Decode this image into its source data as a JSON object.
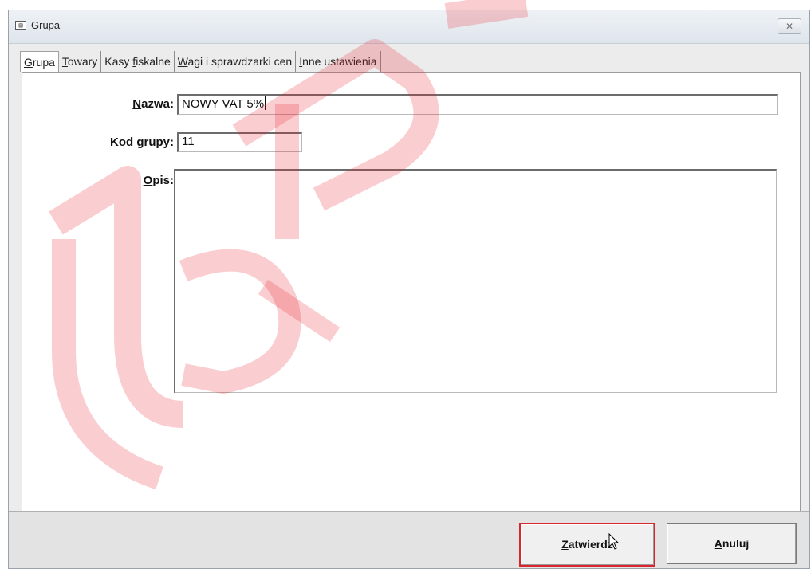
{
  "window": {
    "title": "Grupa",
    "close_glyph": "✕"
  },
  "tabs": [
    {
      "accel": "G",
      "rest": "rupa",
      "active": true
    },
    {
      "accel": "T",
      "rest": "owary",
      "active": false
    },
    {
      "pre": "Kasy ",
      "accel": "f",
      "rest": "iskalne",
      "active": false
    },
    {
      "accel": "W",
      "rest": "agi i sprawdzarki cen",
      "active": false
    },
    {
      "accel": "I",
      "rest": "nne ustawienia",
      "active": false
    }
  ],
  "form": {
    "name_label": {
      "accel": "N",
      "rest": "azwa:"
    },
    "name_value": "NOWY VAT 5%",
    "code_label": {
      "accel": "K",
      "rest": "od grupy:"
    },
    "code_value": "11",
    "desc_label": {
      "accel": "O",
      "rest": "pis:"
    },
    "desc_value": ""
  },
  "buttons": {
    "confirm": {
      "accel": "Z",
      "rest": "atwierdź"
    },
    "cancel": {
      "accel": "A",
      "rest": "nuluj"
    }
  },
  "colors": {
    "focus_outline": "#d9262e",
    "watermark": "#e8202a"
  },
  "icons": {
    "window_icon": "form-window-icon",
    "close": "close-icon",
    "pointer": "mouse-pointer-icon"
  }
}
